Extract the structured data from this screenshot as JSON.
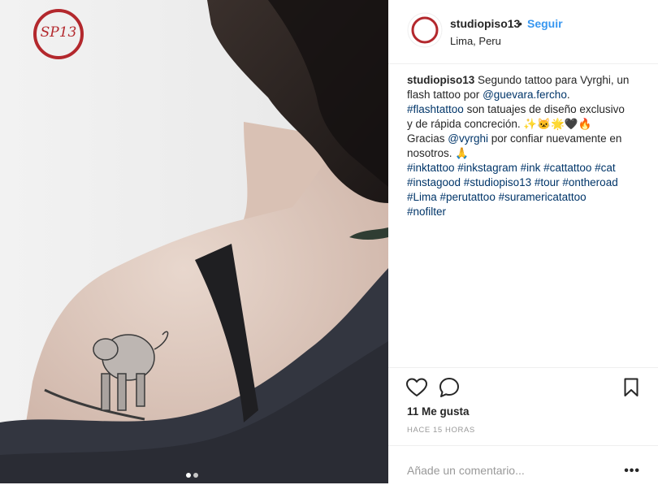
{
  "post": {
    "username": "studiopiso13",
    "separator": "•",
    "follow_label": "Seguir",
    "location": "Lima, Peru",
    "photo_logo_text": "SP13",
    "caption": {
      "author": "studiopiso13",
      "line1_rest": " Segundo tattoo para Vyrghi, un",
      "line2_prefix": "flash tattoo por ",
      "mention1": "@guevara.fercho",
      "line2_suffix": ".",
      "hashtag_flash": "#flashtattoo",
      "line3_rest": " son tatuajes de diseño exclusivo",
      "line4": "y de rápida concreción. ✨🐱🌟🖤🔥",
      "line5_prefix": "Gracias ",
      "mention2": "@vyrghi",
      "line5_suffix": " por confiar nuevamente en",
      "line6": "nosotros. 🙏",
      "hashtags_line1": "#inktattoo #inkstagram #ink #cattattoo #cat",
      "hashtags_line2": "#instagood #studiopiso13 #tour #ontheroad",
      "hashtags_line3": "#Lima #perutattoo #suramericatattoo",
      "hashtags_line4": "#nofilter"
    },
    "likes": "11 Me gusta",
    "time_ago": "HACE 15 HORAS",
    "comment_placeholder": "Añade un comentario...",
    "more_label": "•••",
    "carousel": {
      "count": 2,
      "active_index": 0
    }
  },
  "colors": {
    "brand_red": "#b3282d",
    "link": "#003569",
    "follow_blue": "#3897f0",
    "muted": "#999999",
    "divider": "#efefef"
  }
}
